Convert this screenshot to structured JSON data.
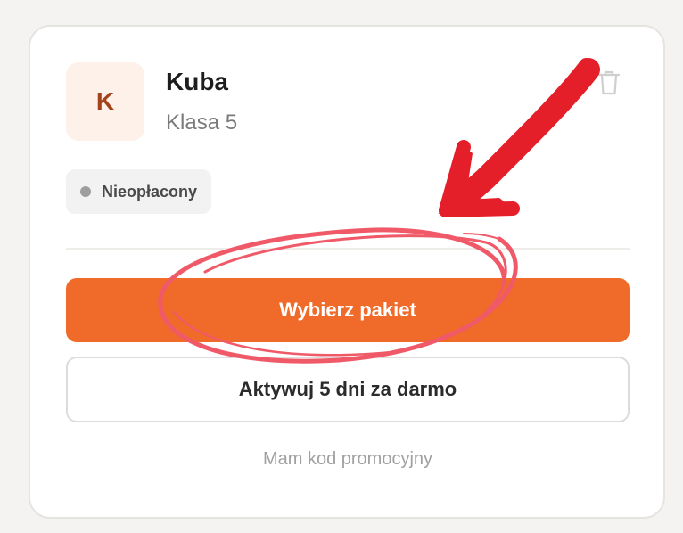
{
  "student": {
    "initial": "K",
    "name": "Kuba",
    "class_label": "Klasa 5"
  },
  "status": {
    "label": "Nieopłacony",
    "dot_color": "#9e9e9e"
  },
  "actions": {
    "choose_package_label": "Wybierz pakiet",
    "free_trial_label": "Aktywuj 5 dni za darmo",
    "promo_code_label": "Mam kod promocyjny"
  },
  "icons": {
    "delete": "trash-icon"
  },
  "colors": {
    "accent": "#f06a2a",
    "annotation_arrow": "#e51f2a",
    "annotation_circle": "#f05a68"
  }
}
